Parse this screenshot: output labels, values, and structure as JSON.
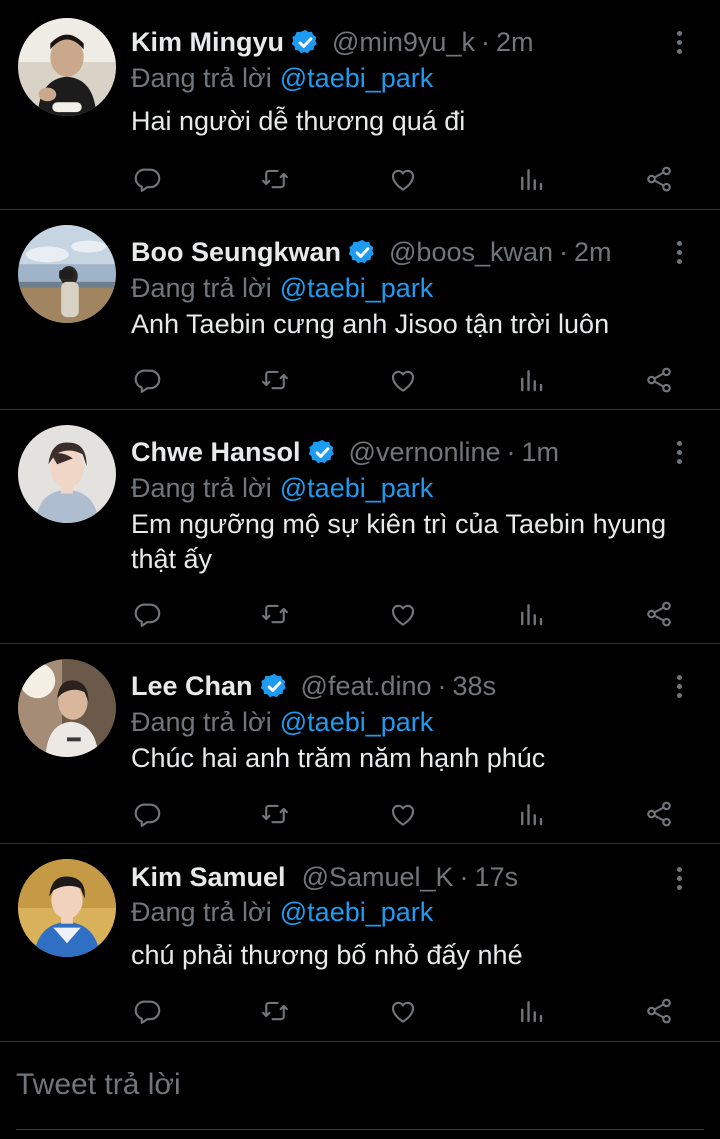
{
  "colors": {
    "background": "#000000",
    "text": "#e7e9ea",
    "muted": "#71767b",
    "accent": "#1d9bf0",
    "divider": "#2f3336"
  },
  "tweets": [
    {
      "name": "Kim Mingyu",
      "verified": true,
      "handle": "@min9yu_k",
      "separator": "·",
      "time": "2m",
      "reply_prefix": "Đang trả lời",
      "reply_to": "@taebi_park",
      "text": "Hai người dễ thương quá đi"
    },
    {
      "name": "Boo Seungkwan",
      "verified": true,
      "handle": "@boos_kwan",
      "separator": "·",
      "time": "2m",
      "reply_prefix": "Đang trả lời",
      "reply_to": "@taebi_park",
      "text": "Anh Taebin cưng anh Jisoo tận trời luôn"
    },
    {
      "name": "Chwe Hansol",
      "verified": true,
      "handle": "@vernonline",
      "separator": "·",
      "time": "1m",
      "reply_prefix": "Đang trả lời",
      "reply_to": "@taebi_park",
      "text": "Em ngưỡng mộ sự kiên trì của Taebin hyung thật ấy"
    },
    {
      "name": "Lee Chan",
      "verified": true,
      "handle": "@feat.dino",
      "separator": "·",
      "time": "38s",
      "reply_prefix": "Đang trả lời",
      "reply_to": "@taebi_park",
      "text": "Chúc hai anh trăm năm hạnh phúc"
    },
    {
      "name": "Kim Samuel",
      "verified": false,
      "handle": "@Samuel_K",
      "separator": "·",
      "time": "17s",
      "reply_prefix": "Đang trả lời",
      "reply_to": "@taebi_park",
      "text": "chú phải thương bố nhỏ đấy nhé"
    }
  ],
  "action_icons": [
    "reply-icon",
    "retweet-icon",
    "like-icon",
    "analytics-icon",
    "share-icon"
  ],
  "composer": {
    "placeholder": "Tweet trả lời"
  }
}
